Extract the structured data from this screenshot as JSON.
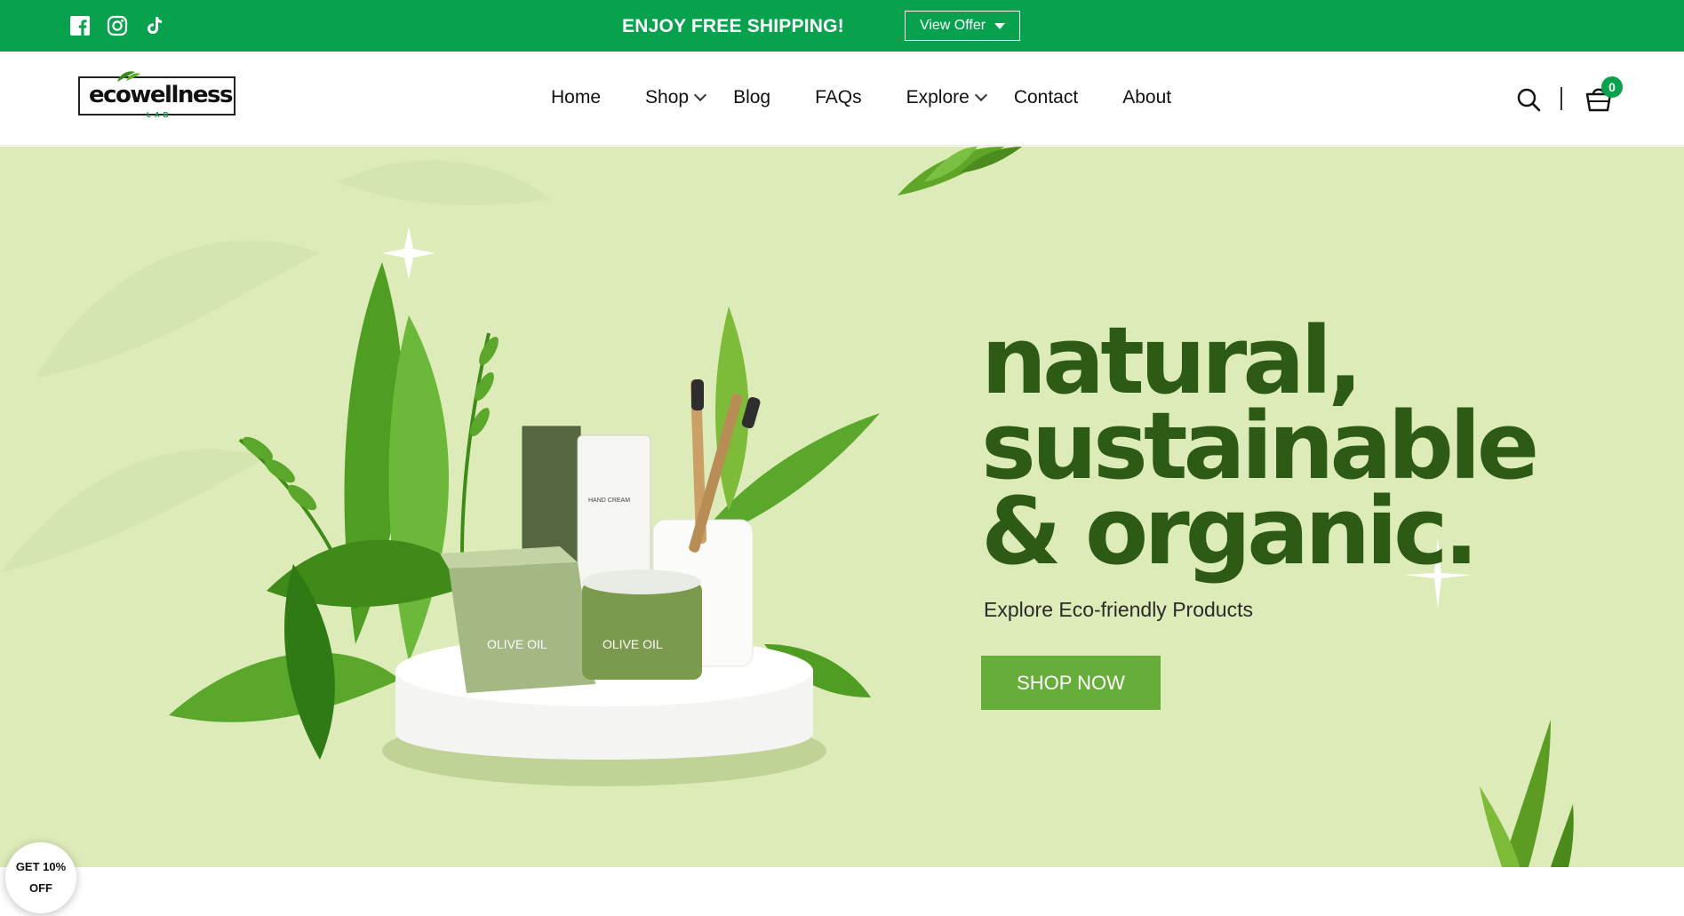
{
  "announcement": {
    "social_icons": [
      "facebook-icon",
      "instagram-icon",
      "tiktok-icon"
    ],
    "text": "ENJOY FREE SHIPPING!",
    "offer_button": "View Offer"
  },
  "header": {
    "logo_text": "ecowellness",
    "logo_sub": "LAB",
    "nav": [
      {
        "label": "Home",
        "has_dropdown": false
      },
      {
        "label": "Shop",
        "has_dropdown": true
      },
      {
        "label": "Blog",
        "has_dropdown": false
      },
      {
        "label": "FAQs",
        "has_dropdown": false
      },
      {
        "label": "Explore",
        "has_dropdown": true
      },
      {
        "label": "Contact",
        "has_dropdown": false
      },
      {
        "label": "About",
        "has_dropdown": false
      }
    ],
    "cart_count": "0",
    "icons": [
      "search-icon",
      "cart-icon"
    ]
  },
  "hero": {
    "headline": [
      "natural,",
      "sustainable",
      "& organic."
    ],
    "subline": "Explore Eco-friendly Products",
    "cta": "SHOP NOW",
    "product_labels": [
      "HAND CREAM",
      "OLIVE OIL",
      "OLIVE OIL"
    ]
  },
  "promo": {
    "line1": "GET 10%",
    "line2": "OFF"
  },
  "colors": {
    "brand_green": "#08a14e",
    "hero_bg": "#dcebb8",
    "headline": "#2d5a14",
    "cta": "#67ad39"
  }
}
